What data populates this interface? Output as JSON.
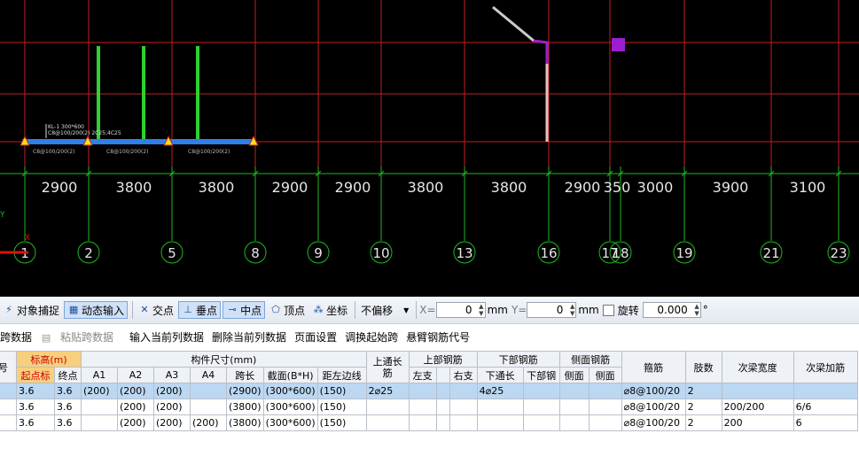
{
  "cad": {
    "axis_numbers": [
      "1",
      "2",
      "5",
      "8",
      "9",
      "10",
      "13",
      "16",
      "17",
      "18",
      "19",
      "21",
      "23"
    ],
    "span_labels": [
      "2900",
      "3800",
      "3800",
      "2900",
      "2900",
      "3800",
      "3800",
      "2900",
      "350",
      "3000",
      "3900",
      "3100"
    ],
    "beam_annotation": [
      "KL-1 300*600",
      "C8@100/200(2) 2C25;4C25"
    ],
    "stirrup_labels": [
      "C8@100/200(2)",
      "C8@100/200(2)",
      "C8@100/200(2)"
    ],
    "axis_y_label": "Y",
    "axis_x_label": "X",
    "colors": {
      "background": "#000000",
      "grid_red": "#c41e1e",
      "grid_green": "#20b820",
      "beam_blue": "#2f7fe8",
      "accent_purple": "#9b1fd1"
    }
  },
  "snapbar": {
    "object_snap": "对象捕捉",
    "dynamic_input": "动态输入",
    "intersection": "交点",
    "perpendicular": "垂点",
    "midpoint": "中点",
    "vertex": "顶点",
    "coordinate": "坐标",
    "offset_mode": "不偏移",
    "x_label": "X=",
    "x_value": "0",
    "x_unit": "mm",
    "y_label": "Y=",
    "y_value": "0",
    "y_unit": "mm",
    "rotate_label": "旋转",
    "rotate_value": "0.000",
    "degree": "°"
  },
  "opbar": {
    "copy": "跨数据",
    "paste": "粘贴跨数据",
    "input_col": "输入当前列数据",
    "delete_col": "删除当前列数据",
    "page_setup": "页面设置",
    "swap_start": "调换起始跨",
    "cantilever": "悬臂钢筋代号"
  },
  "table": {
    "h_no": "号",
    "h_elev": "标高(m)",
    "h_start": "起点标",
    "h_end": "终点",
    "h_dims": "构件尺寸(mm)",
    "h_a1": "A1",
    "h_a2": "A2",
    "h_a3": "A3",
    "h_a4": "A4",
    "h_span": "跨长",
    "h_section": "截面(B*H)",
    "h_dist": "距左边线",
    "h_top_through": "上通长筋",
    "h_top_bars": "上部钢筋",
    "h_left": "左支",
    "h_mid": "",
    "h_right": "右支",
    "h_bottom_bars": "下部钢筋",
    "h_bot_through": "下通长",
    "h_bot_part": "下部钢",
    "h_side_bars": "侧面钢筋",
    "h_side1": "侧面",
    "h_side2": "侧面",
    "h_stirrup": "箍筋",
    "h_legs": "肢数",
    "h_sec_width": "次梁宽度",
    "h_sec_add": "次梁加筋",
    "rows": [
      {
        "start": "3.6",
        "end": "3.6",
        "a1": "(200)",
        "a2": "(200)",
        "a3": "(200)",
        "a4": "",
        "span": "(2900)",
        "section": "(300*600)",
        "dist": "(150)",
        "top": "2⌀25",
        "left": "",
        "mid": "",
        "right": "",
        "bot": "4⌀25",
        "botp": "",
        "s1": "",
        "s2": "",
        "stirrup": "⌀8@100/20",
        "legs": "2",
        "secw": "",
        "seca": ""
      },
      {
        "start": "3.6",
        "end": "3.6",
        "a1": "",
        "a2": "(200)",
        "a3": "(200)",
        "a4": "",
        "span": "(3800)",
        "section": "(300*600)",
        "dist": "(150)",
        "top": "",
        "left": "",
        "mid": "",
        "right": "",
        "bot": "",
        "botp": "",
        "s1": "",
        "s2": "",
        "stirrup": "⌀8@100/20",
        "legs": "2",
        "secw": "200/200",
        "seca": "6/6"
      },
      {
        "start": "3.6",
        "end": "3.6",
        "a1": "",
        "a2": "(200)",
        "a3": "(200)",
        "a4": "(200)",
        "span": "(3800)",
        "section": "(300*600)",
        "dist": "(150)",
        "top": "",
        "left": "",
        "mid": "",
        "right": "",
        "bot": "",
        "botp": "",
        "s1": "",
        "s2": "",
        "stirrup": "⌀8@100/20",
        "legs": "2",
        "secw": "200",
        "seca": "6"
      }
    ]
  }
}
